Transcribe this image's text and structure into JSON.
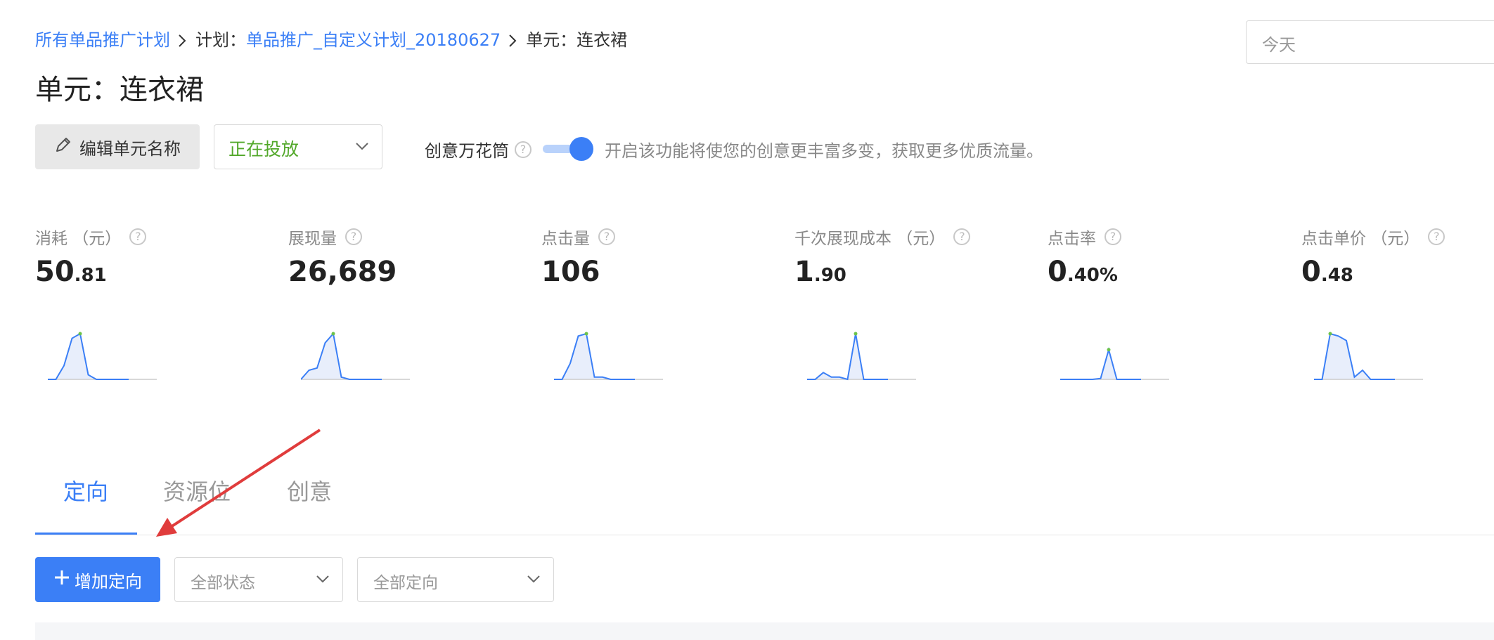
{
  "breadcrumb": {
    "root": "所有单品推广计划",
    "plan_prefix": "计划：",
    "plan_name": "单品推广_自定义计划_20180627",
    "unit": "单元：连衣裙"
  },
  "date_picker": {
    "value": "今天"
  },
  "page_title": "单元：连衣裙",
  "toolbar": {
    "edit_label": "编辑单元名称",
    "status_value": "正在投放",
    "kaleidoscope_label": "创意万花筒",
    "kaleidoscope_enabled": true,
    "kaleidoscope_desc": "开启该功能将使您的创意更丰富多变，获取更多优质流量。"
  },
  "metrics": [
    {
      "label": "消耗 （元）",
      "int": "50",
      "dec": ".81",
      "spark": [
        0,
        0,
        0.3,
        0.9,
        1,
        0.1,
        0,
        0,
        0,
        0,
        0
      ]
    },
    {
      "label": "展现量",
      "int": "26,689",
      "dec": "",
      "spark": [
        0,
        0.2,
        0.25,
        0.8,
        1,
        0.05,
        0,
        0,
        0,
        0,
        0
      ]
    },
    {
      "label": "点击量",
      "int": "106",
      "dec": "",
      "spark": [
        0,
        0,
        0.35,
        0.95,
        1,
        0.05,
        0.05,
        0,
        0,
        0,
        0
      ]
    },
    {
      "label": "千次展现成本 （元）",
      "int": "1",
      "dec": ".90",
      "spark": [
        0,
        0,
        0.15,
        0.05,
        0.05,
        0,
        1,
        0,
        0,
        0,
        0
      ]
    },
    {
      "label": "点击率",
      "int": "0",
      "dec": ".40%",
      "spark": [
        0,
        0,
        0,
        0,
        0,
        0.02,
        0.65,
        0,
        0,
        0,
        0
      ]
    },
    {
      "label": "点击单价 （元）",
      "int": "0",
      "dec": ".48",
      "spark": [
        0,
        0,
        1,
        0.95,
        0.85,
        0.05,
        0.2,
        0,
        0,
        0,
        0
      ]
    }
  ],
  "tabs": [
    "定向",
    "资源位",
    "创意"
  ],
  "active_tab": 0,
  "actions": {
    "add_label": "增加定向",
    "status_filter": "全部状态",
    "targeting_filter": "全部定向"
  },
  "colors": {
    "accent": "#3b7ff6",
    "status_green": "#52a82a",
    "annotation_arrow": "#e03c3c"
  }
}
